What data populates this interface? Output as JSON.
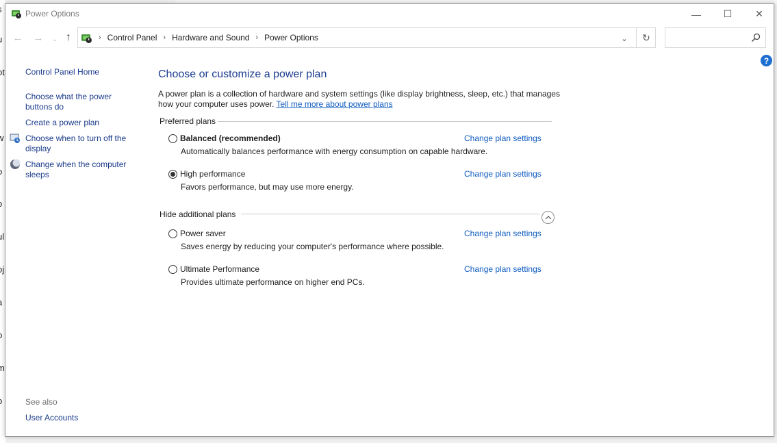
{
  "window": {
    "title": "Power Options"
  },
  "titlebar": {
    "minimize_glyph": "—",
    "maximize_glyph": "☐",
    "close_glyph": "✕"
  },
  "navigation": {
    "back_glyph": "←",
    "forward_glyph": "→",
    "recent_glyph": "⌄",
    "up_glyph": "↑",
    "breadcrumbs": [
      "Control Panel",
      "Hardware and Sound",
      "Power Options"
    ],
    "separator": "›",
    "dropdown_glyph": "⌄",
    "refresh_glyph": "↻",
    "search_placeholder": ""
  },
  "help": {
    "glyph": "?"
  },
  "sidebar": {
    "home_link": "Control Panel Home",
    "links": [
      {
        "label": "Choose what the power buttons do",
        "icon": null
      },
      {
        "label": "Create a power plan",
        "icon": null
      },
      {
        "label": "Choose when to turn off the display",
        "icon": "display-icon"
      },
      {
        "label": "Change when the computer sleeps",
        "icon": "sleep-moon-icon"
      }
    ],
    "see_also_label": "See also",
    "see_also_links": [
      "User Accounts"
    ]
  },
  "main": {
    "heading": "Choose or customize a power plan",
    "description": "A power plan is a collection of hardware and system settings (like display brightness, sleep, etc.) that manages how your computer uses power. ",
    "description_link": "Tell me more about power plans",
    "preferred_label": "Preferred plans",
    "additional_label": "Hide additional plans",
    "change_settings_label": "Change plan settings",
    "preferred_plans": [
      {
        "name": "Balanced (recommended)",
        "description": "Automatically balances performance with energy consumption on capable hardware.",
        "selected": false
      },
      {
        "name": "High performance",
        "description": "Favors performance, but may use more energy.",
        "selected": true
      }
    ],
    "additional_plans": [
      {
        "name": "Power saver",
        "description": "Saves energy by reducing your computer's performance where possible.",
        "selected": false
      },
      {
        "name": "Ultimate Performance",
        "description": "Provides ultimate performance on higher end PCs.",
        "selected": false
      }
    ]
  },
  "background": {
    "left_edge_letters": [
      "s",
      "u",
      "ot",
      "w",
      "o",
      "o",
      "ul",
      "oj",
      "a",
      "p",
      "m",
      "o"
    ]
  },
  "colors": {
    "link": "#1a3a8a",
    "heading": "#1c3d8f",
    "accent_link": "#0f5cc0",
    "help_badge": "#1c6fd1"
  }
}
